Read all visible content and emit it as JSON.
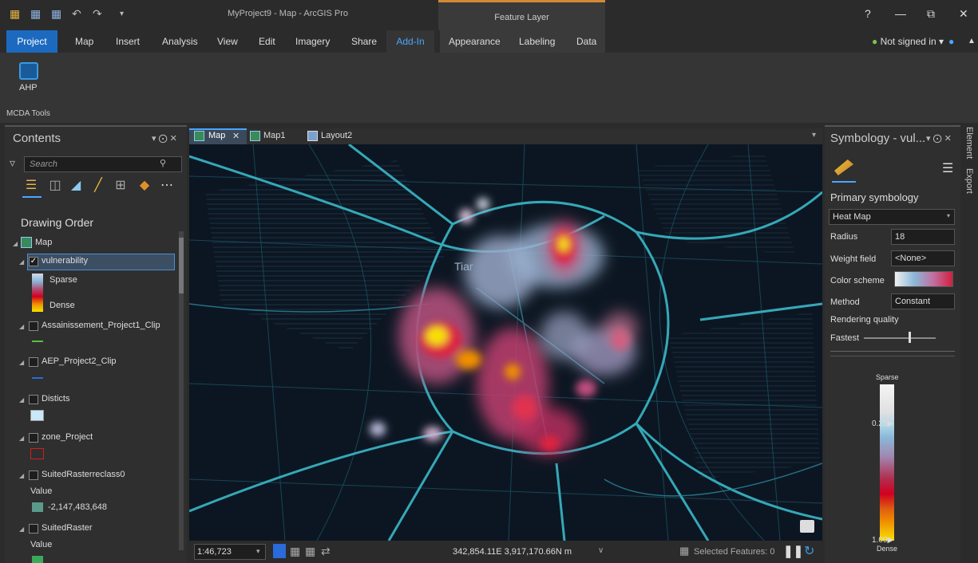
{
  "window": {
    "title": "MyProject9 - Map - ArcGIS Pro",
    "context_tab_header": "Feature Layer",
    "help": "?",
    "minimize": "—",
    "restore": "⧉",
    "close": "✕"
  },
  "ribbon_tabs": [
    "Project",
    "Map",
    "Insert",
    "Analysis",
    "View",
    "Edit",
    "Imagery",
    "Share",
    "Add-In",
    "Appearance",
    "Labeling",
    "Data"
  ],
  "user": {
    "signin": "Not signed in",
    "caret": "▾"
  },
  "ribbon": {
    "ahp_label": "AHP",
    "group_label": "MCDA Tools"
  },
  "contents": {
    "title": "Contents",
    "pin": "▾ ⨀ ✕",
    "search_placeholder": "Search",
    "heading": "Drawing Order",
    "map_node": "Map",
    "layers": {
      "vulnerability": "vulnerability",
      "sparse": "Sparse",
      "dense": "Dense",
      "assain": "Assainissement_Project1_Clip",
      "aep": "AEP_Project2_Clip",
      "disticts": "Disticts",
      "zone": "zone_Project",
      "suited_reclass": "SuitedRasterreclass0",
      "value1": "Value",
      "value1_item": "-2,147,483,648",
      "suited": "SuitedRaster",
      "value2": "Value"
    }
  },
  "map": {
    "tabs": [
      {
        "label": "Map",
        "close": "✕"
      },
      {
        "label": "Map1"
      },
      {
        "label": "Layout2"
      }
    ],
    "label_town": "Tiar",
    "scale": "1:46,723",
    "coords": "342,854.11E 3,917,170.66N m",
    "selected": "Selected Features: 0"
  },
  "symbology": {
    "title": "Symbology - vul...",
    "controls": "▾ ⨀ ✕",
    "section": "Primary symbology",
    "renderer": "Heat Map",
    "radius_label": "Radius",
    "radius_value": "18",
    "weight_label": "Weight field",
    "weight_value": "<None>",
    "color_label": "Color scheme",
    "method_label": "Method",
    "method_value": "Constant",
    "quality_label": "Rendering quality",
    "quality_value": "Fastest",
    "ramp_top": "Sparse",
    "ramp_025": "0.25",
    "ramp_100": "1.00",
    "ramp_bottom": "Dense"
  },
  "side_tabs": [
    "Element",
    "Export"
  ]
}
